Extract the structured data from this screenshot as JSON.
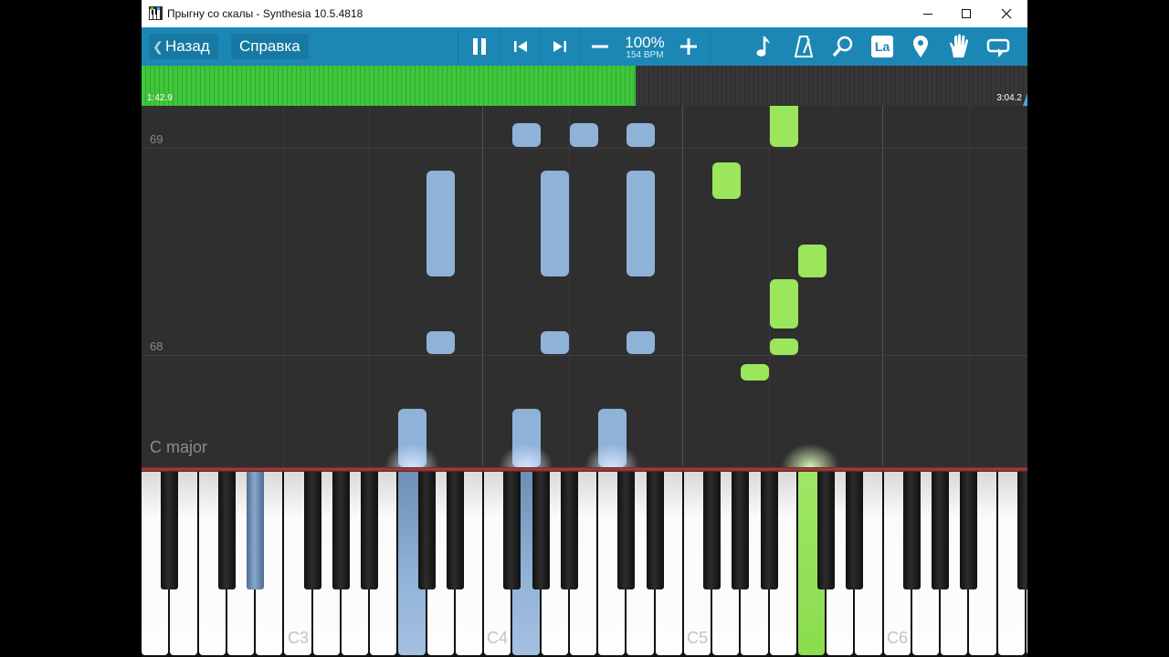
{
  "window": {
    "title": "Прыгну со скалы - Synthesia 10.5.4818"
  },
  "toolbar": {
    "back_label": "Назад",
    "help_label": "Справка",
    "speed_percent": "100%",
    "tempo": "154 BPM",
    "icons": [
      "pause-icon",
      "skip-back-icon",
      "skip-forward-icon",
      "minus-icon",
      "plus-icon",
      "note-icon",
      "metronome-icon",
      "magnifier-icon",
      "note-labels-icon",
      "map-pin-icon",
      "hand-icon",
      "loop-icon"
    ],
    "note_labels_icon_text": "La"
  },
  "progress": {
    "current": "1:42.9",
    "total": "3:04.2",
    "fraction": 0.558
  },
  "roll": {
    "row_labels": [
      "69",
      "68"
    ],
    "key_signature": "C major"
  },
  "keyboard": {
    "octave_labels": [
      "C3",
      "C4",
      "C5",
      "C6"
    ],
    "pressed_blue": [
      "F#3 area",
      "C4 area",
      "F4 area"
    ],
    "pressed_green": [
      "G5 area"
    ]
  },
  "colors": {
    "toolbar": "#1c87b4",
    "played_progress": "#3fc63c",
    "left_hand_note": "#8fb2d9",
    "right_hand_note": "#9be65b",
    "background": "#2f2f2f"
  }
}
